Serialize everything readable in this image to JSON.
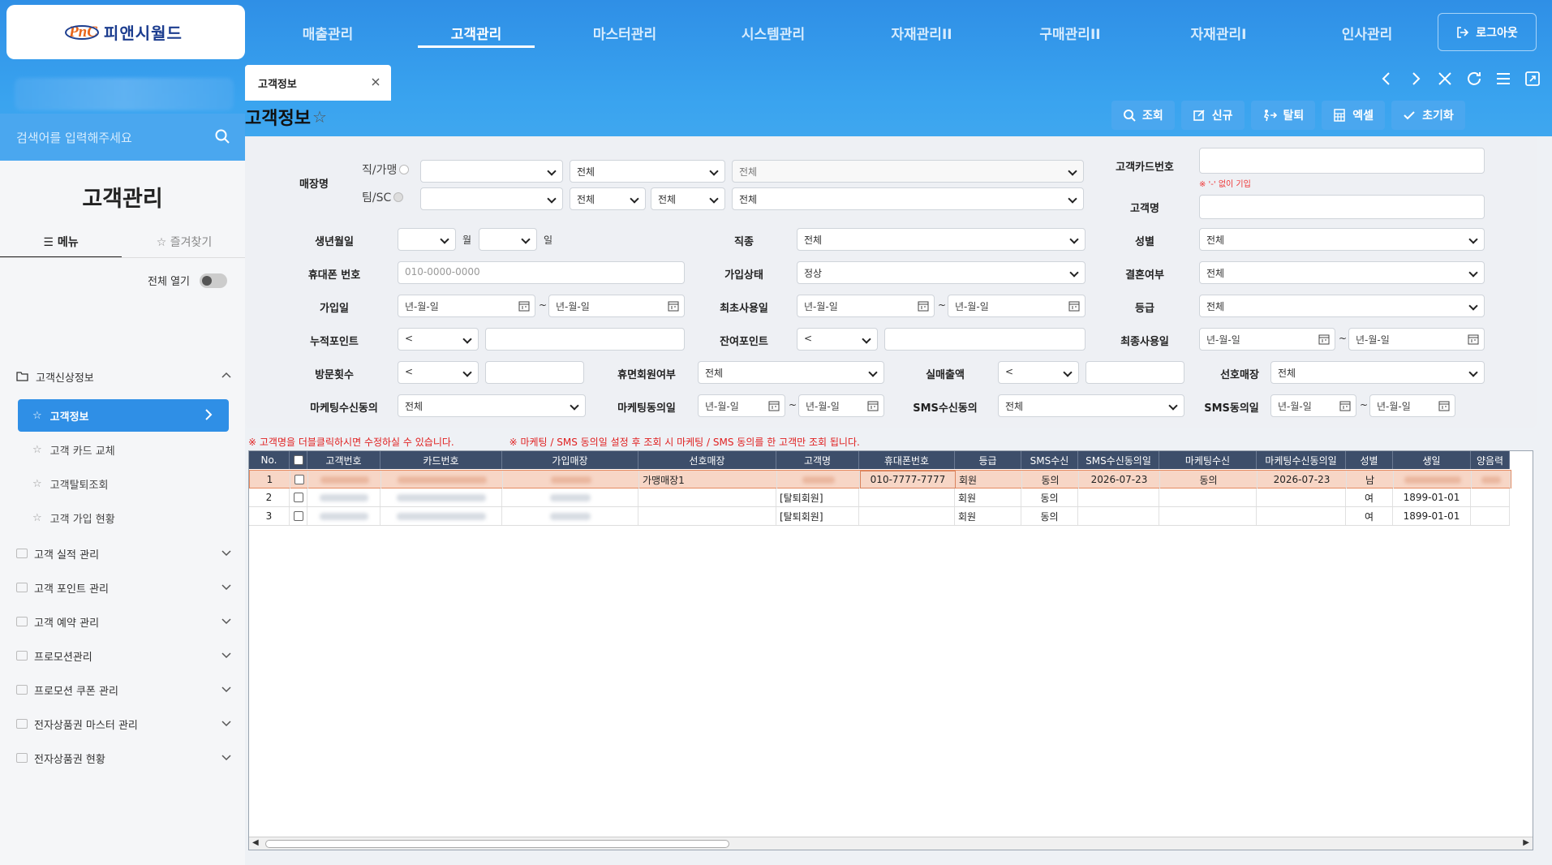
{
  "brand": {
    "logo_text": "PnC",
    "company_name": "피앤시월드"
  },
  "topnav": {
    "items": [
      "매출관리",
      "고객관리",
      "마스터관리",
      "시스템관리",
      "자재관리II",
      "구매관리II",
      "자재관리I",
      "인사관리"
    ],
    "active_index": 1,
    "logout_label": "로그아웃"
  },
  "sidebar": {
    "search_placeholder": "검색어를 입력해주세요",
    "title": "고객관리",
    "tabs": [
      "메뉴",
      "즐겨찾기"
    ],
    "expand_all_label": "전체 열기",
    "groups": [
      {
        "label": "고객신상정보",
        "expanded": true,
        "items": [
          "고객정보",
          "고객 카드 교체",
          "고객탈퇴조회",
          "고객 가입 현황"
        ]
      },
      {
        "label": "고객 실적 관리"
      },
      {
        "label": "고객 포인트 관리"
      },
      {
        "label": "고객 예약 관리"
      },
      {
        "label": "프로모션관리"
      },
      {
        "label": "프로모션 쿠폰 관리"
      },
      {
        "label": "전자상품권 마스터 관리"
      },
      {
        "label": "전자상품권 현황"
      }
    ]
  },
  "content_tab": {
    "label": "고객정보"
  },
  "page_title": "고객정보",
  "actions": {
    "search": "조회",
    "new": "신규",
    "withdraw": "탈퇴",
    "excel": "엑셀",
    "reset": "초기화"
  },
  "filters": {
    "store_label": "매장명",
    "direct_franchise": "직/가맹",
    "team_sc": "팀/SC",
    "all": "전체",
    "card_no_label": "고객카드번호",
    "card_no_note": "※ '-' 없이 기입",
    "name_label": "고객명",
    "birth_label": "생년월일",
    "month": "월",
    "day": "일",
    "job_label": "직종",
    "gender_label": "성별",
    "phone_label": "휴대폰 번호",
    "phone_placeholder": "010-0000-0000",
    "join_status_label": "가입상태",
    "join_status_value": "정상",
    "married_label": "결혼여부",
    "join_date_label": "가입일",
    "date_placeholder": "년-월-일",
    "first_use_label": "최초사용일",
    "grade_label": "등급",
    "acc_point_label": "누적포인트",
    "lt": "<",
    "remain_point_label": "잔여포인트",
    "last_use_label": "최종사용일",
    "visit_label": "방문횟수",
    "dormant_label": "휴면회원여부",
    "sales_label": "실매출액",
    "pref_store_label": "선호매장",
    "mkt_consent_label": "마케팅수신동의",
    "mkt_date_label": "마케팅동의일",
    "sms_consent_label": "SMS수신동의",
    "sms_date_label": "SMS동의일"
  },
  "notes": [
    "※ 고객명을 더블클릭하시면 수정하실 수 있습니다.",
    "※ 마케팅 / SMS 동의일 설정 후 조회 시 마케팅 / SMS 동의를 한 고객만 조회 됩니다."
  ],
  "grid": {
    "columns": [
      "No.",
      "",
      "고객번호",
      "카드번호",
      "가입매장",
      "선호매장",
      "고객명",
      "휴대폰번호",
      "등급",
      "SMS수신",
      "SMS수신동의일",
      "마케팅수신",
      "마케팅수신동의일",
      "성별",
      "생일",
      "양음력"
    ],
    "rows": [
      {
        "no": "1",
        "pref_store": "가맹매장1",
        "name": "",
        "phone": "010-7777-7777",
        "grade": "회원",
        "sms": "동의",
        "sms_date": "2026-07-23",
        "mkt": "동의",
        "mkt_date": "2026-07-23",
        "gender": "남",
        "birth": ""
      },
      {
        "no": "2",
        "pref_store": "",
        "name": "[탈퇴회원]",
        "phone": "",
        "grade": "회원",
        "sms": "동의",
        "sms_date": "",
        "mkt": "",
        "mkt_date": "",
        "gender": "여",
        "birth": "1899-01-01"
      },
      {
        "no": "3",
        "pref_store": "",
        "name": "[탈퇴회원]",
        "phone": "",
        "grade": "회원",
        "sms": "동의",
        "sms_date": "",
        "mkt": "",
        "mkt_date": "",
        "gender": "여",
        "birth": "1899-01-01"
      }
    ]
  },
  "colors": {
    "primary": "#2f8fe6",
    "header_blue": "#3fa7ef",
    "grid_header": "#3d4e6a",
    "selected_row": "#f7d6c6",
    "note_red": "#e02020"
  }
}
